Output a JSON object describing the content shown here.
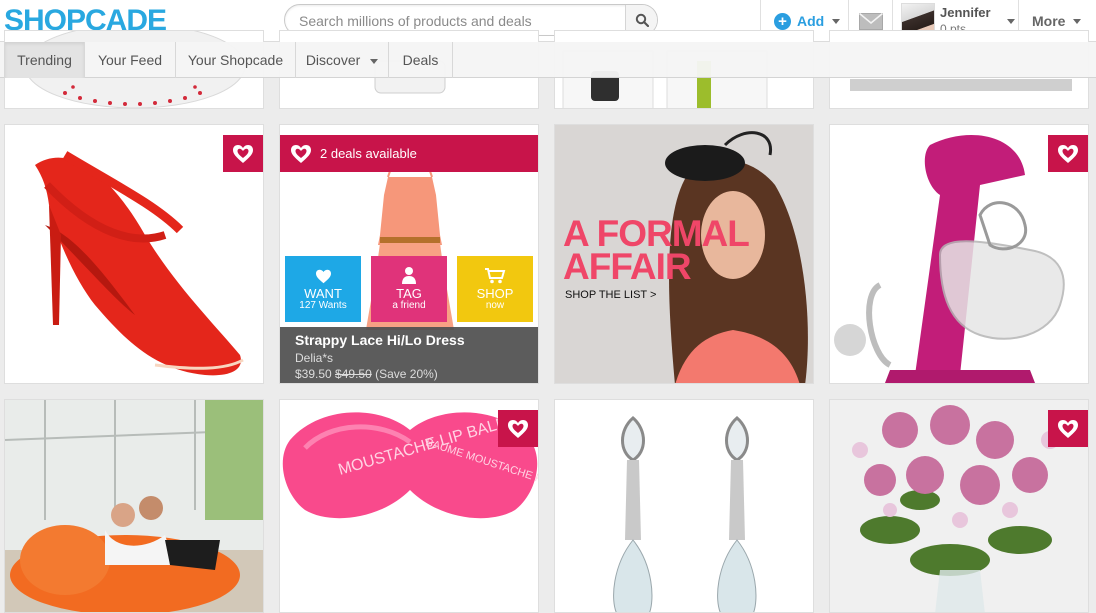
{
  "brand": {
    "logo_text": "SHOPCADE"
  },
  "search": {
    "placeholder": "Search millions of products and deals"
  },
  "header": {
    "add_label": "Add",
    "user_name": "Jennifer",
    "user_points": "0 pts",
    "more_label": "More"
  },
  "nav": {
    "tabs": [
      {
        "label": "Trending"
      },
      {
        "label": "Your Feed"
      },
      {
        "label": "Your Shopcade"
      },
      {
        "label": "Discover"
      },
      {
        "label": "Deals"
      }
    ]
  },
  "deal_card": {
    "banner": "2 deals available",
    "want": {
      "label": "WANT",
      "sub": "127 Wants"
    },
    "tag": {
      "label": "TAG",
      "sub": "a friend"
    },
    "shop": {
      "label": "SHOP",
      "sub": "now"
    },
    "product_name": "Strappy Lace Hi/Lo Dress",
    "store": "Delia*s",
    "price": "$39.50",
    "old_price": "$49.50",
    "savings": "(Save 20%)"
  },
  "promo_card": {
    "title_line1": "A FORMAL",
    "title_line2": "AFFAIR",
    "link": "SHOP THE LIST >"
  },
  "lip_balm": {
    "left_text": "MOUSTACHE LIP BALM",
    "right_text": "BAUME MOUSTACHE POUR LES LEVRES"
  },
  "colors": {
    "brand_blue": "#29a8e0",
    "deal_pink": "#c8144a",
    "want_blue": "#1ea8e6",
    "tag_pink": "#e0337a",
    "shop_yellow": "#f2c80f",
    "promo_pink": "#ef4668"
  }
}
